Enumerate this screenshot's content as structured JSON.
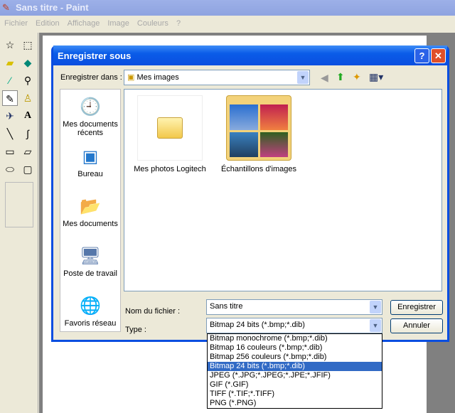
{
  "app": {
    "title": "Sans titre - Paint",
    "menu": [
      "Fichier",
      "Edition",
      "Affichage",
      "Image",
      "Couleurs",
      "?"
    ]
  },
  "dialog": {
    "title": "Enregistrer sous",
    "help_label": "?",
    "close_label": "✕",
    "save_in_label": "Enregistrer dans :",
    "save_in_value": "Mes images",
    "places": [
      "Mes documents récents",
      "Bureau",
      "Mes documents",
      "Poste de travail",
      "Favoris réseau"
    ],
    "files": [
      "Mes photos Logitech",
      "Échantillons d'images"
    ],
    "filename_label": "Nom du fichier :",
    "filename_value": "Sans titre",
    "type_label": "Type :",
    "type_value": "Bitmap 24 bits (*.bmp;*.dib)",
    "save_button": "Enregistrer",
    "cancel_button": "Annuler",
    "type_options": [
      "Bitmap monochrome (*.bmp;*.dib)",
      "Bitmap 16 couleurs (*.bmp;*.dib)",
      "Bitmap 256 couleurs (*.bmp;*.dib)",
      "Bitmap 24 bits (*.bmp;*.dib)",
      "JPEG (*.JPG;*.JPEG;*.JPE;*.JFIF)",
      "GIF (*.GIF)",
      "TIFF (*.TIF;*.TIFF)",
      "PNG (*.PNG)"
    ],
    "selected_option": 3
  }
}
